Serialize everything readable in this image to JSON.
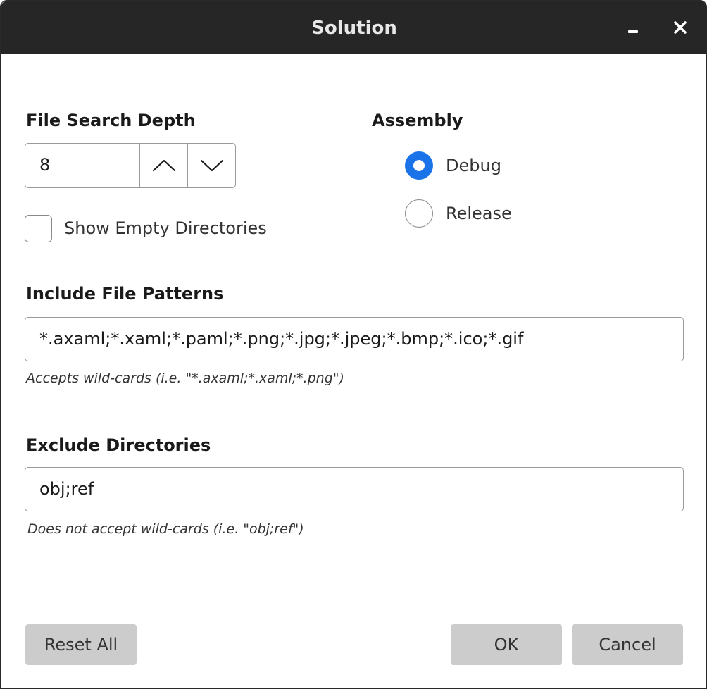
{
  "window": {
    "title": "Solution"
  },
  "file_search_depth": {
    "label": "File Search Depth",
    "value": "8"
  },
  "show_empty_directories": {
    "label": "Show Empty Directories",
    "checked": false
  },
  "assembly": {
    "label": "Assembly",
    "options": [
      {
        "label": "Debug",
        "selected": true
      },
      {
        "label": "Release",
        "selected": false
      }
    ]
  },
  "include_file_patterns": {
    "label": "Include File Patterns",
    "value": "*.axaml;*.xaml;*.paml;*.png;*.jpg;*.jpeg;*.bmp;*.ico;*.gif",
    "hint": "Accepts wild-cards (i.e. \"*.axaml;*.xaml;*.png\")"
  },
  "exclude_directories": {
    "label": "Exclude Directories",
    "value": "obj;ref",
    "hint": "Does not accept wild-cards (i.e. \"obj;ref\")"
  },
  "buttons": {
    "reset_all": "Reset All",
    "ok": "OK",
    "cancel": "Cancel"
  },
  "colors": {
    "titlebar": "#262626",
    "accent": "#1a73e8",
    "button_bg": "#cccccc"
  },
  "icons": {
    "minimize": "minimize-icon",
    "close": "close-icon",
    "up": "chevron-up-icon",
    "down": "chevron-down-icon"
  }
}
